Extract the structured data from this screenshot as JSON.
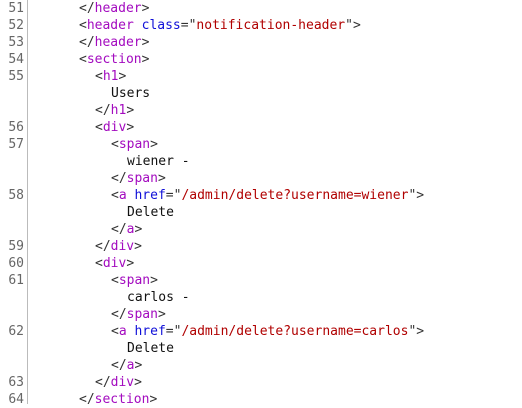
{
  "lines": [
    {
      "n": "51",
      "indent": 3,
      "tokens": [
        {
          "t": "</",
          "c": "p"
        },
        {
          "t": "header",
          "c": "tag"
        },
        {
          "t": ">",
          "c": "p"
        }
      ]
    },
    {
      "n": "52",
      "indent": 3,
      "tokens": [
        {
          "t": "<",
          "c": "p"
        },
        {
          "t": "header",
          "c": "tag"
        },
        {
          "t": " ",
          "c": "p"
        },
        {
          "t": "class",
          "c": "attr"
        },
        {
          "t": "=\"",
          "c": "p"
        },
        {
          "t": "notification-header",
          "c": "val"
        },
        {
          "t": "\">",
          "c": "p"
        }
      ]
    },
    {
      "n": "53",
      "indent": 3,
      "tokens": [
        {
          "t": "</",
          "c": "p"
        },
        {
          "t": "header",
          "c": "tag"
        },
        {
          "t": ">",
          "c": "p"
        }
      ]
    },
    {
      "n": "54",
      "indent": 3,
      "tokens": [
        {
          "t": "<",
          "c": "p"
        },
        {
          "t": "section",
          "c": "tag"
        },
        {
          "t": ">",
          "c": "p"
        }
      ]
    },
    {
      "n": "55",
      "indent": 4,
      "tokens": [
        {
          "t": "<",
          "c": "p"
        },
        {
          "t": "h1",
          "c": "tag"
        },
        {
          "t": ">",
          "c": "p"
        }
      ]
    },
    {
      "n": "",
      "indent": 5,
      "tokens": [
        {
          "t": "Users",
          "c": "txt"
        }
      ]
    },
    {
      "n": "",
      "indent": 4,
      "tokens": [
        {
          "t": "</",
          "c": "p"
        },
        {
          "t": "h1",
          "c": "tag"
        },
        {
          "t": ">",
          "c": "p"
        }
      ]
    },
    {
      "n": "56",
      "indent": 4,
      "tokens": [
        {
          "t": "<",
          "c": "p"
        },
        {
          "t": "div",
          "c": "tag"
        },
        {
          "t": ">",
          "c": "p"
        }
      ]
    },
    {
      "n": "57",
      "indent": 5,
      "tokens": [
        {
          "t": "<",
          "c": "p"
        },
        {
          "t": "span",
          "c": "tag"
        },
        {
          "t": ">",
          "c": "p"
        }
      ]
    },
    {
      "n": "",
      "indent": 6,
      "tokens": [
        {
          "t": "wiener -",
          "c": "txt"
        }
      ]
    },
    {
      "n": "",
      "indent": 5,
      "tokens": [
        {
          "t": "</",
          "c": "p"
        },
        {
          "t": "span",
          "c": "tag"
        },
        {
          "t": ">",
          "c": "p"
        }
      ]
    },
    {
      "n": "58",
      "indent": 5,
      "tokens": [
        {
          "t": "<",
          "c": "p"
        },
        {
          "t": "a",
          "c": "tag"
        },
        {
          "t": " ",
          "c": "p"
        },
        {
          "t": "href",
          "c": "attr"
        },
        {
          "t": "=\"",
          "c": "p"
        },
        {
          "t": "/admin/delete?username=wiener",
          "c": "val"
        },
        {
          "t": "\">",
          "c": "p"
        }
      ]
    },
    {
      "n": "",
      "indent": 6,
      "tokens": [
        {
          "t": "Delete",
          "c": "txt"
        }
      ]
    },
    {
      "n": "",
      "indent": 5,
      "tokens": [
        {
          "t": "</",
          "c": "p"
        },
        {
          "t": "a",
          "c": "tag"
        },
        {
          "t": ">",
          "c": "p"
        }
      ]
    },
    {
      "n": "59",
      "indent": 4,
      "tokens": [
        {
          "t": "</",
          "c": "p"
        },
        {
          "t": "div",
          "c": "tag"
        },
        {
          "t": ">",
          "c": "p"
        }
      ]
    },
    {
      "n": "60",
      "indent": 4,
      "tokens": [
        {
          "t": "<",
          "c": "p"
        },
        {
          "t": "div",
          "c": "tag"
        },
        {
          "t": ">",
          "c": "p"
        }
      ]
    },
    {
      "n": "61",
      "indent": 5,
      "tokens": [
        {
          "t": "<",
          "c": "p"
        },
        {
          "t": "span",
          "c": "tag"
        },
        {
          "t": ">",
          "c": "p"
        }
      ]
    },
    {
      "n": "",
      "indent": 6,
      "tokens": [
        {
          "t": "carlos -",
          "c": "txt"
        }
      ]
    },
    {
      "n": "",
      "indent": 5,
      "tokens": [
        {
          "t": "</",
          "c": "p"
        },
        {
          "t": "span",
          "c": "tag"
        },
        {
          "t": ">",
          "c": "p"
        }
      ]
    },
    {
      "n": "62",
      "indent": 5,
      "tokens": [
        {
          "t": "<",
          "c": "p"
        },
        {
          "t": "a",
          "c": "tag"
        },
        {
          "t": " ",
          "c": "p"
        },
        {
          "t": "href",
          "c": "attr"
        },
        {
          "t": "=\"",
          "c": "p"
        },
        {
          "t": "/admin/delete?username=carlos",
          "c": "val"
        },
        {
          "t": "\">",
          "c": "p"
        }
      ]
    },
    {
      "n": "",
      "indent": 6,
      "tokens": [
        {
          "t": "Delete",
          "c": "txt"
        }
      ]
    },
    {
      "n": "",
      "indent": 5,
      "tokens": [
        {
          "t": "</",
          "c": "p"
        },
        {
          "t": "a",
          "c": "tag"
        },
        {
          "t": ">",
          "c": "p"
        }
      ]
    },
    {
      "n": "63",
      "indent": 4,
      "tokens": [
        {
          "t": "</",
          "c": "p"
        },
        {
          "t": "div",
          "c": "tag"
        },
        {
          "t": ">",
          "c": "p"
        }
      ]
    },
    {
      "n": "64",
      "indent": 3,
      "tokens": [
        {
          "t": "</",
          "c": "p"
        },
        {
          "t": "section",
          "c": "tag"
        },
        {
          "t": ">",
          "c": "p"
        }
      ]
    }
  ]
}
